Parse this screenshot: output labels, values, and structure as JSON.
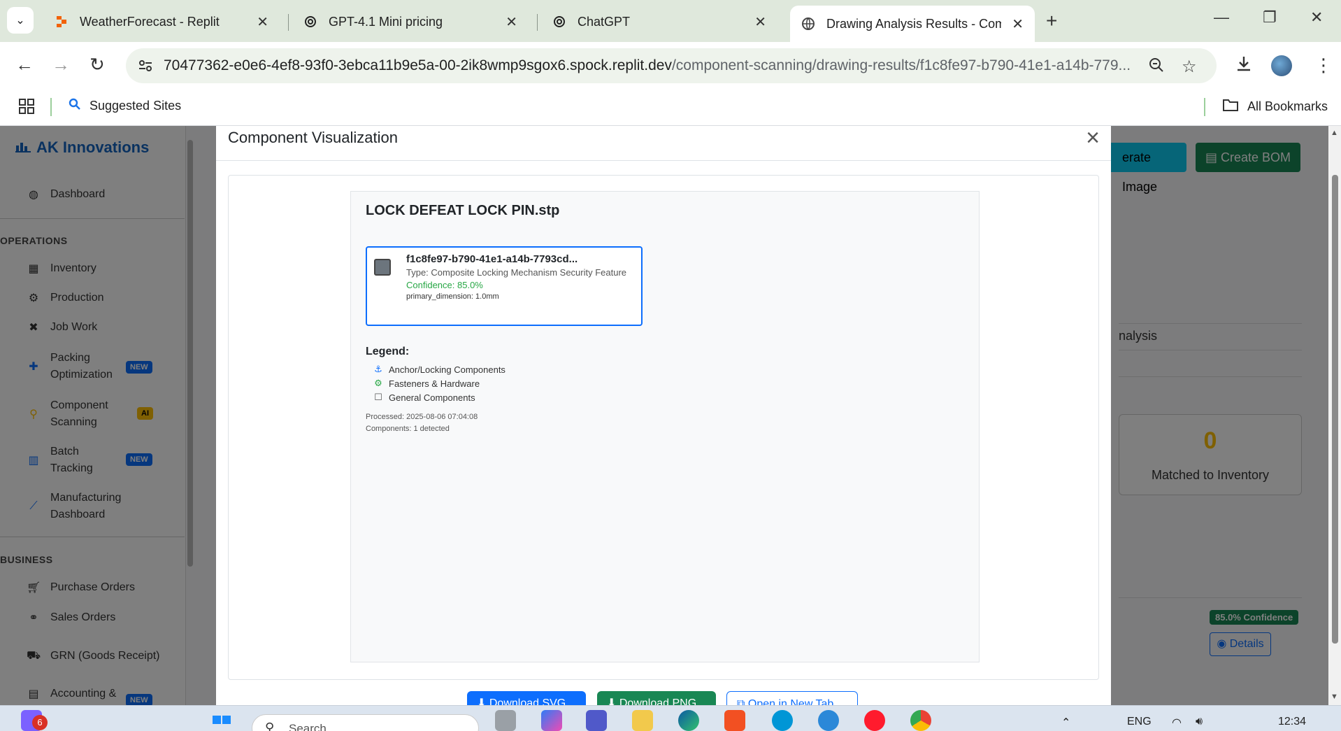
{
  "browser": {
    "tabs": [
      {
        "title": "WeatherForecast - Replit",
        "icon": "replit-icon",
        "active": false
      },
      {
        "title": "GPT-4.1 Mini pricing",
        "icon": "openai-icon",
        "active": false
      },
      {
        "title": "ChatGPT",
        "icon": "openai-icon",
        "active": false
      },
      {
        "title": "Drawing Analysis Results - Com",
        "icon": "globe-icon",
        "active": true
      }
    ],
    "new_tab_label": "+",
    "url_host": "70477362-e0e6-4ef8-93f0-3ebca11b9e5a-00-2ik8wmp9sgox6.spock.replit.dev",
    "url_path": "/component-scanning/drawing-results/f1c8fe97-b790-41e1-a14b-779...",
    "bookmarks": {
      "suggested": "Suggested Sites",
      "all": "All Bookmarks"
    }
  },
  "sidebar": {
    "brand": "AK Innovations",
    "dashboard": "Dashboard",
    "sections": {
      "operations": "OPERATIONS",
      "business": "BUSINESS"
    },
    "items": {
      "inventory": "Inventory",
      "production": "Production",
      "job_work": "Job Work",
      "packing_1": "Packing",
      "packing_2": "Optimization",
      "component_1": "Component",
      "component_2": "Scanning",
      "batch_1": "Batch",
      "batch_2": "Tracking",
      "mfg_1": "Manufacturing",
      "mfg_2": "Dashboard",
      "purchase": "Purchase Orders",
      "sales": "Sales Orders",
      "grn": "GRN (Goods Receipt)",
      "accounting": "Accounting &"
    },
    "badges": {
      "new": "NEW",
      "ai": "AI"
    }
  },
  "right_panel": {
    "generate_label": "erate Image",
    "bom_label": "Create BOM",
    "analysis_label": "nalysis",
    "matched_count": "0",
    "matched_label": "Matched to Inventory",
    "confidence_badge": "85.0% Confidence",
    "details_label": "Details"
  },
  "modal": {
    "title": "Component Visualization",
    "close": "×",
    "file_name": "LOCK DEFEAT LOCK PIN.stp",
    "component": {
      "id": "f1c8fe97-b790-41e1-a14b-7793cd...",
      "type": "Type: Composite Locking Mechanism Security Feature",
      "confidence": "Confidence: 85.0%",
      "dimension": "primary_dimension: 1.0mm"
    },
    "legend": {
      "title": "Legend:",
      "items": [
        "Anchor/Locking Components",
        "Fasteners & Hardware",
        "General Components"
      ]
    },
    "processed": "Processed: 2025-08-06 07:04:08",
    "components": "Components: 1 detected",
    "buttons": {
      "svg": "Download SVG",
      "png": "Download PNG",
      "new_tab": "Open in New Tab"
    }
  },
  "taskbar": {
    "search_placeholder": "Search",
    "notification_count": "6",
    "language": "ENG",
    "time": "12:34"
  },
  "colors": {
    "primary": "#0d6efd",
    "success": "#198754",
    "warning": "#ffc107",
    "info": "#0dcaf0"
  }
}
